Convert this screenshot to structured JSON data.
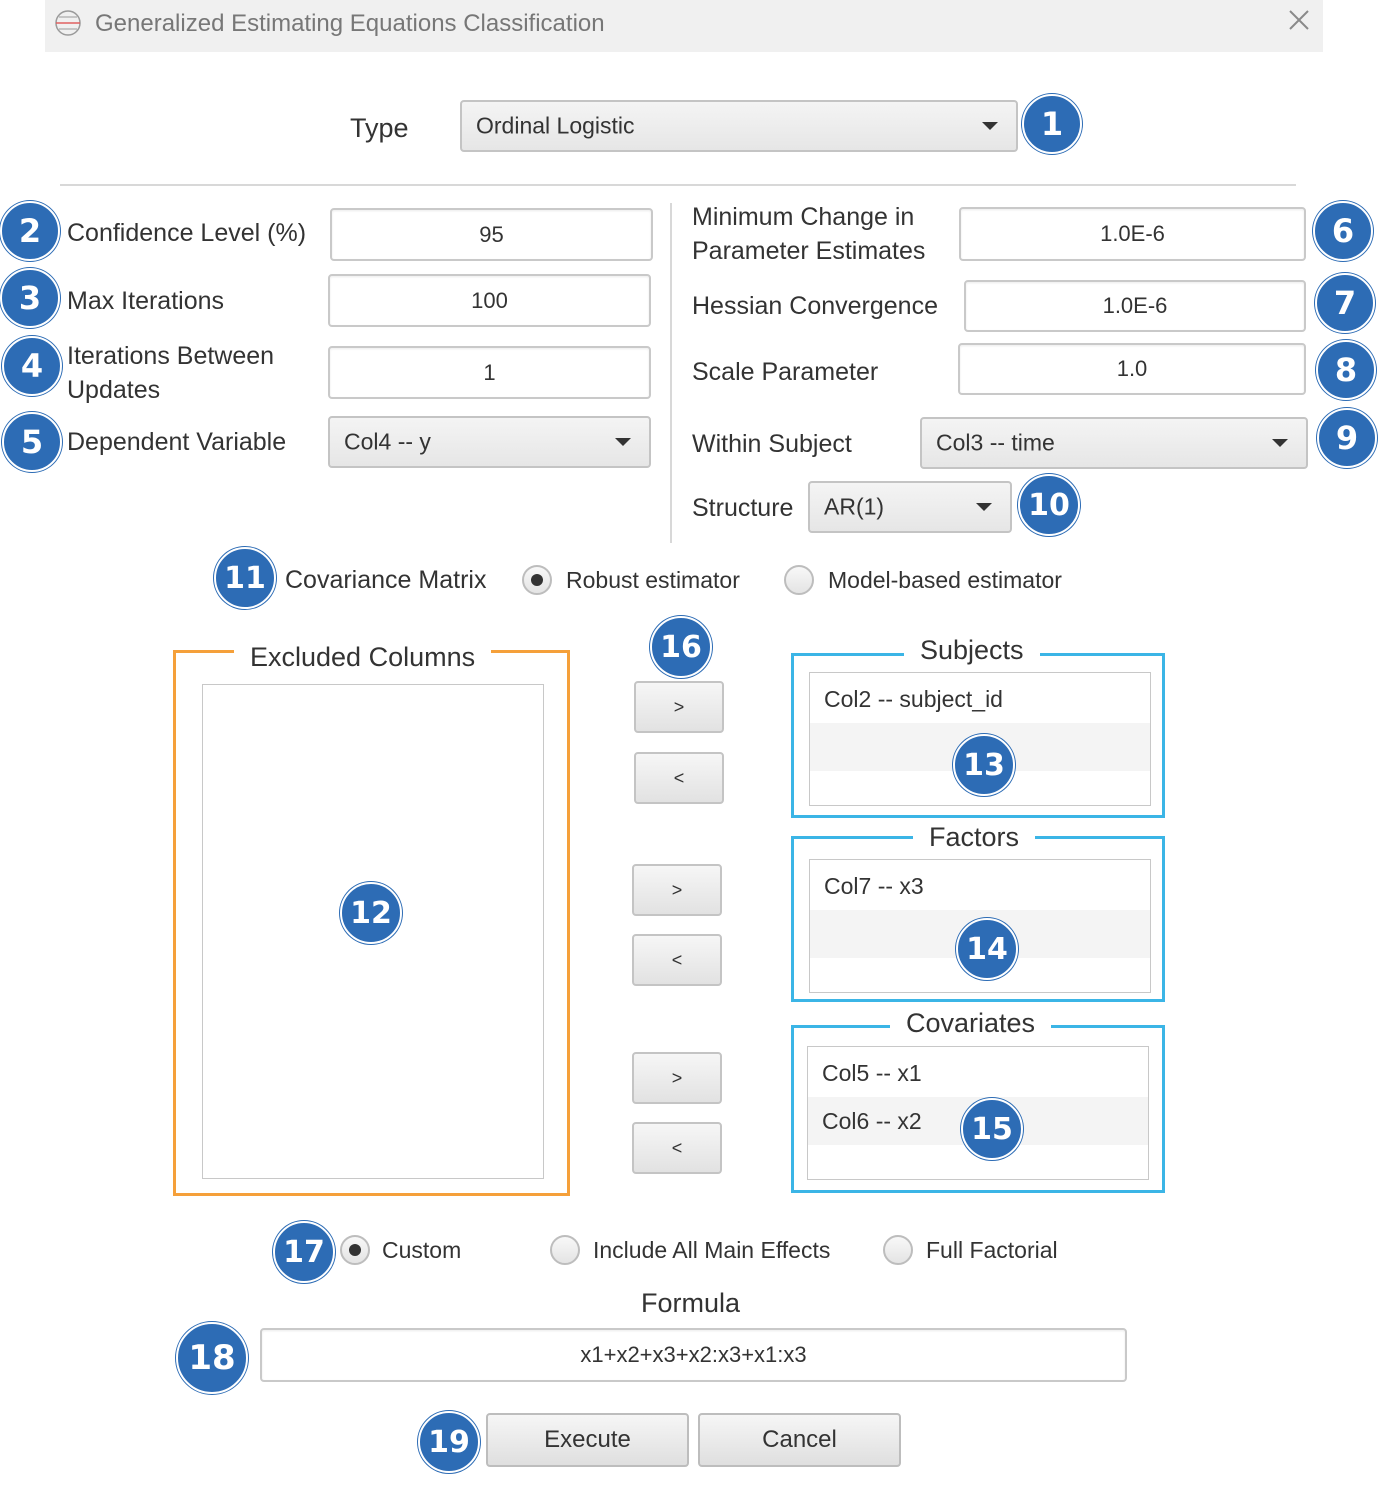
{
  "window": {
    "title": "Generalized Estimating Equations Classification"
  },
  "type": {
    "label": "Type",
    "value": "Ordinal Logistic",
    "badge": "1"
  },
  "left_fields": {
    "confidence": {
      "label": "Confidence Level (%)",
      "value": "95",
      "badge": "2"
    },
    "max_iterations": {
      "label": "Max Iterations",
      "value": "100",
      "badge": "3"
    },
    "iterations_between_updates": {
      "label": "Iterations Between Updates",
      "value": "1",
      "badge": "4"
    },
    "dependent_variable": {
      "label": "Dependent Variable",
      "value": "Col4 -- y",
      "badge": "5"
    }
  },
  "right_fields": {
    "min_change": {
      "label": "Minimum Change in Parameter Estimates",
      "value": "1.0E-6",
      "badge": "6"
    },
    "hessian": {
      "label": "Hessian Convergence",
      "value": "1.0E-6",
      "badge": "7"
    },
    "scale": {
      "label": "Scale Parameter",
      "value": "1.0",
      "badge": "8"
    },
    "within_subject": {
      "label": "Within Subject",
      "value": "Col3 -- time",
      "badge": "9"
    },
    "structure": {
      "label": "Structure",
      "value": "AR(1)",
      "badge": "10"
    }
  },
  "covariance": {
    "label": "Covariance Matrix",
    "badge": "11",
    "options": [
      "Robust estimator",
      "Model-based estimator"
    ],
    "selected": "Robust estimator"
  },
  "excluded": {
    "title": "Excluded Columns",
    "badge": "12",
    "items": []
  },
  "move_buttons": {
    "badge": "16",
    "add": ">",
    "remove": "<"
  },
  "subjects": {
    "title": "Subjects",
    "badge": "13",
    "items": [
      "Col2 -- subject_id"
    ]
  },
  "factors": {
    "title": "Factors",
    "badge": "14",
    "items": [
      "Col7 -- x3"
    ]
  },
  "covariates": {
    "title": "Covariates",
    "badge": "15",
    "items": [
      "Col5 -- x1",
      "Col6 -- x2"
    ]
  },
  "model": {
    "badge": "17",
    "options": [
      "Custom",
      "Include All Main Effects",
      "Full Factorial"
    ],
    "selected": "Custom"
  },
  "formula": {
    "label": "Formula",
    "value": "x1+x2+x3+x2:x3+x1:x3",
    "badge": "18"
  },
  "actions": {
    "execute": "Execute",
    "cancel": "Cancel",
    "badge": "19"
  },
  "colors": {
    "badge": "#2d6cb5",
    "excluded_frame": "#f5a03a",
    "selected_frame": "#3bb5e6"
  }
}
